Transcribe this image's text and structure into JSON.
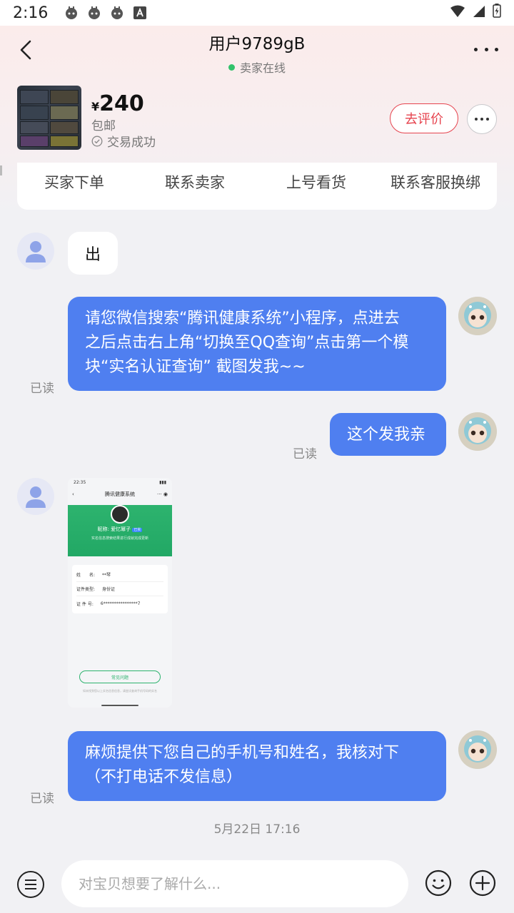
{
  "status_bar": {
    "time": "2:16",
    "notification_icons": [
      "android-debug-icon",
      "android-debug-icon",
      "android-debug-icon",
      "font-a-icon"
    ],
    "right_icons": [
      "wifi-icon",
      "signal-icon",
      "battery-icon"
    ]
  },
  "header": {
    "title": "用户9789gB",
    "online_status": "卖家在线",
    "online_color": "#32c26b"
  },
  "product": {
    "currency": "¥",
    "price": "240",
    "shipping": "包邮",
    "trade_status": "交易成功",
    "review_button": "去评价"
  },
  "quick_actions": [
    "买家下单",
    "联系卖家",
    "上号看货",
    "联系客服换绑"
  ],
  "messages": [
    {
      "side": "left",
      "text": "出"
    },
    {
      "side": "right",
      "lines": [
        "请您微信搜索“腾讯健康系统”小程序，点进去",
        "之后点击右上角“切换至QQ查询”点击第一个模",
        "块“实名认证查询” 截图发我~~"
      ],
      "read": "已读"
    },
    {
      "side": "right",
      "lines": [
        "这个发我亲"
      ],
      "read": "已读"
    },
    {
      "side": "left",
      "type": "image",
      "image": {
        "status_time": "22:35",
        "nav_title": "腾讯健康系统",
        "nickname": "昵称: 爱忆幂子",
        "verified_badge": "已实",
        "subtitle": "实名信息搜索结果进行成就完成更新",
        "rows": [
          {
            "label": "姓　　名:",
            "value": "**琴"
          },
          {
            "label": "证件类型:",
            "value": "身份证"
          },
          {
            "label": "证 件 号:",
            "value": "6****************7"
          }
        ],
        "faq_button": "常见问题",
        "footer": "如未找到您以上实名信息信息，请尝试查询手机号码的实名"
      }
    },
    {
      "side": "right",
      "lines": [
        "麻烦提供下您自己的手机号和姓名，我核对下",
        "（不打电话不发信息）"
      ],
      "read": "已读"
    }
  ],
  "timestamp": "5月22日 17:16",
  "input": {
    "placeholder": "对宝贝想要了解什么..."
  },
  "colors": {
    "accent_blue": "#4f7ff0",
    "review_red": "#e6434e"
  }
}
